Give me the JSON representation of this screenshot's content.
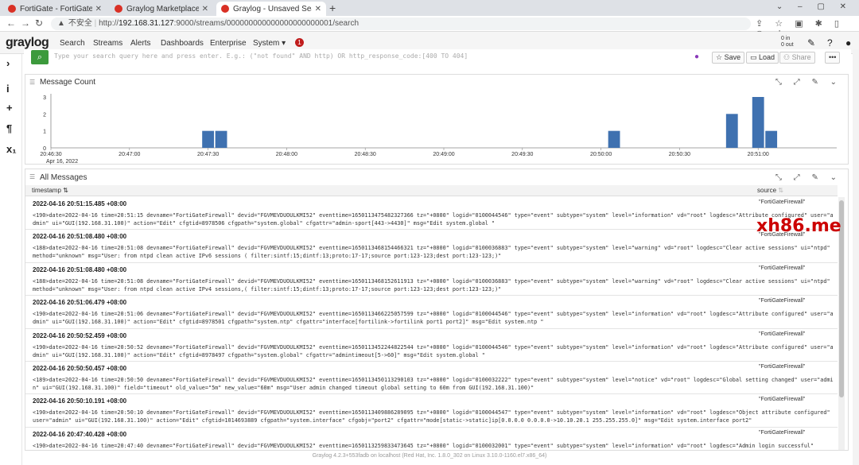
{
  "browser": {
    "tabs": [
      {
        "title": "FortiGate - FortiGateFirewall",
        "active": false,
        "color": "#d93025"
      },
      {
        "title": "Graylog Marketplace",
        "active": false,
        "color": "#d93025"
      },
      {
        "title": "Graylog - Unsaved Search",
        "active": true,
        "color": "#d93025"
      }
    ],
    "security_label": "不安全",
    "url_prefix": "http://",
    "url_host": "192.168.31.127",
    "url_rest": ":9000/streams/000000000000000000000001/search"
  },
  "app": {
    "logo": "graylog",
    "nav": [
      "Search",
      "Streams",
      "Alerts",
      "Dashboards",
      "Enterprise",
      "System ▾"
    ],
    "notification_count": "1",
    "throughput_in": "0 in",
    "throughput_out": "0 out"
  },
  "search": {
    "placeholder": "Type your search query here and press enter. E.g.: (\"not found\" AND http) OR http_response_code:[400 TO 404]",
    "save_label": "Save",
    "load_label": "Load",
    "share_label": "Share"
  },
  "message_count": {
    "title": "Message Count",
    "chart_data": {
      "type": "bar",
      "title": "Message Count",
      "x_ticks": [
        "20:46:30",
        "20:47:00",
        "20:47:30",
        "20:48:00",
        "20:48:30",
        "20:49:00",
        "20:49:30",
        "20:50:00",
        "20:50:30",
        "20:51:00"
      ],
      "x_sub_label": "Apr 16, 2022",
      "y_ticks": [
        "0",
        "1",
        "2",
        "3"
      ],
      "ylim": [
        0,
        3
      ],
      "bars": [
        {
          "time": "20:47:30",
          "value": 1
        },
        {
          "time": "20:47:35",
          "value": 1
        },
        {
          "time": "20:50:05",
          "value": 1
        },
        {
          "time": "20:50:50",
          "value": 2
        },
        {
          "time": "20:51:00",
          "value": 3
        },
        {
          "time": "20:51:05",
          "value": 1
        }
      ]
    }
  },
  "messages": {
    "title": "All Messages",
    "col_timestamp": "timestamp",
    "col_source": "source",
    "rows": [
      {
        "ts": "2022-04-16 20:51:15.485 +08:00",
        "source": "\"FortiGateFirewall\"",
        "msg": "<190>date=2022-04-16 time=20:51:15 devname=\"FortiGateFirewall\" devid=\"FGVMEVDUOULKMI52\" eventtime=1650113475482327366 tz=\"+0800\" logid=\"0100044546\" type=\"event\" subtype=\"system\" level=\"information\" vd=\"root\" logdesc=\"Attribute configured\" user=\"admin\" ui=\"GUI(192.168.31.100)\" action=\"Edit\" cfgtid=8978506 cfgpath=\"system.global\" cfgattr=\"admin-sport[443->4430]\" msg=\"Edit system.global \""
      },
      {
        "ts": "2022-04-16 20:51:08.480 +08:00",
        "source": "\"FortiGateFirewall\"",
        "msg": "<188>date=2022-04-16 time=20:51:08 devname=\"FortiGateFirewall\" devid=\"FGVMEVDUOULKMI52\" eventtime=1650113468154466321 tz=\"+0800\" logid=\"0100036883\" type=\"event\" subtype=\"system\" level=\"warning\" vd=\"root\" logdesc=\"Clear active sessions\" ui=\"ntpd\" method=\"unknown\" msg=\"User: from ntpd clean active IPv6 sessions ( filter:sintf:15;dintf:13;proto:17-17;source port:123-123;dest port:123-123;)\""
      },
      {
        "ts": "2022-04-16 20:51:08.480 +08:00",
        "source": "\"FortiGateFirewall\"",
        "msg": "<188>date=2022-04-16 time=20:51:08 devname=\"FortiGateFirewall\" devid=\"FGVMEVDUOULKMI52\" eventtime=1650113468152611913 tz=\"+0800\" logid=\"0100036883\" type=\"event\" subtype=\"system\" level=\"warning\" vd=\"root\" logdesc=\"Clear active sessions\" ui=\"ntpd\" method=\"unknown\" msg=\"User: from ntpd clean active IPv4 sessions,( filter:sintf:15;dintf:13;proto:17-17;source port:123-123;dest port:123-123;)\""
      },
      {
        "ts": "2022-04-16 20:51:06.479 +08:00",
        "source": "\"FortiGateFirewall\"",
        "msg": "<190>date=2022-04-16 time=20:51:06 devname=\"FortiGateFirewall\" devid=\"FGVMEVDUOULKMI52\" eventtime=1650113466225057599 tz=\"+0800\" logid=\"0100044546\" type=\"event\" subtype=\"system\" level=\"information\" vd=\"root\" logdesc=\"Attribute configured\" user=\"admin\" ui=\"GUI(192.168.31.100)\" action=\"Edit\" cfgtid=8978501 cfgpath=\"system.ntp\" cfgattr=\"interface[fortilink->fortilink port1 port2]\" msg=\"Edit system.ntp \""
      },
      {
        "ts": "2022-04-16 20:50:52.459 +08:00",
        "source": "\"FortiGateFirewall\"",
        "msg": "<190>date=2022-04-16 time=20:50:52 devname=\"FortiGateFirewall\" devid=\"FGVMEVDUOULKMI52\" eventtime=1650113452244822544 tz=\"+0800\" logid=\"0100044546\" type=\"event\" subtype=\"system\" level=\"information\" vd=\"root\" logdesc=\"Attribute configured\" user=\"admin\" ui=\"GUI(192.168.31.100)\" action=\"Edit\" cfgtid=8978497 cfgpath=\"system.global\" cfgattr=\"admintimeout[5->60]\" msg=\"Edit system.global \""
      },
      {
        "ts": "2022-04-16 20:50:50.457 +08:00",
        "source": "\"FortiGateFirewall\"",
        "msg": "<189>date=2022-04-16 time=20:50:50 devname=\"FortiGateFirewall\" devid=\"FGVMEVDUOULKMI52\" eventtime=1650113450113290103 tz=\"+0800\" logid=\"0100032222\" type=\"event\" subtype=\"system\" level=\"notice\" vd=\"root\" logdesc=\"Global setting changed\" user=\"admin\" ui=\"GUI(192.168.31.100)\" field=\"timeout\" old_value=\"5m\" new_value=\"60m\" msg=\"User admin changed timeout global setting to 60m from GUI(192.168.31.100)\""
      },
      {
        "ts": "2022-04-16 20:50:10.191 +08:00",
        "source": "\"FortiGateFirewall\"",
        "msg": "<190>date=2022-04-16 time=20:50:10 devname=\"FortiGateFirewall\" devid=\"FGVMEVDUOULKMI52\" eventtime=1650113409886289095 tz=\"+0800\" logid=\"0100044547\" type=\"event\" subtype=\"system\" level=\"information\" vd=\"root\" logdesc=\"Object attribute configured\" user=\"admin\" ui=\"GUI(192.168.31.100)\" action=\"Edit\" cfgtid=1014693889 cfgpath=\"system.interface\" cfgobj=\"port2\" cfgattr=\"mode[static->static]ip[0.0.0.0 0.0.0.0->10.10.20.1 255.255.255.0]\" msg=\"Edit system.interface port2\""
      },
      {
        "ts": "2022-04-16 20:47:40.428 +08:00",
        "source": "\"FortiGateFirewall\"",
        "msg": "<190>date=2022-04-16 time=20:47:40 devname=\"FortiGateFirewall\" devid=\"FGVMEVDUOULKMI52\" eventtime=1650113259833473645 tz=\"+0800\" logid=\"0100032001\" type=\"event\" subtype=\"system\" level=\"information\" vd=\"root\" logdesc=\"Admin login successful\""
      }
    ]
  },
  "footer": "Graylog 4.2.3+553fadb on localhost (Red Hat, Inc. 1.8.0_302 on Linux 3.10.0-1160.el7.x86_64)",
  "watermark": "xh86.me",
  "colors": {
    "bar": "#3f71b0",
    "accent": "#3c9a3c",
    "badge": "#c01c1c"
  }
}
